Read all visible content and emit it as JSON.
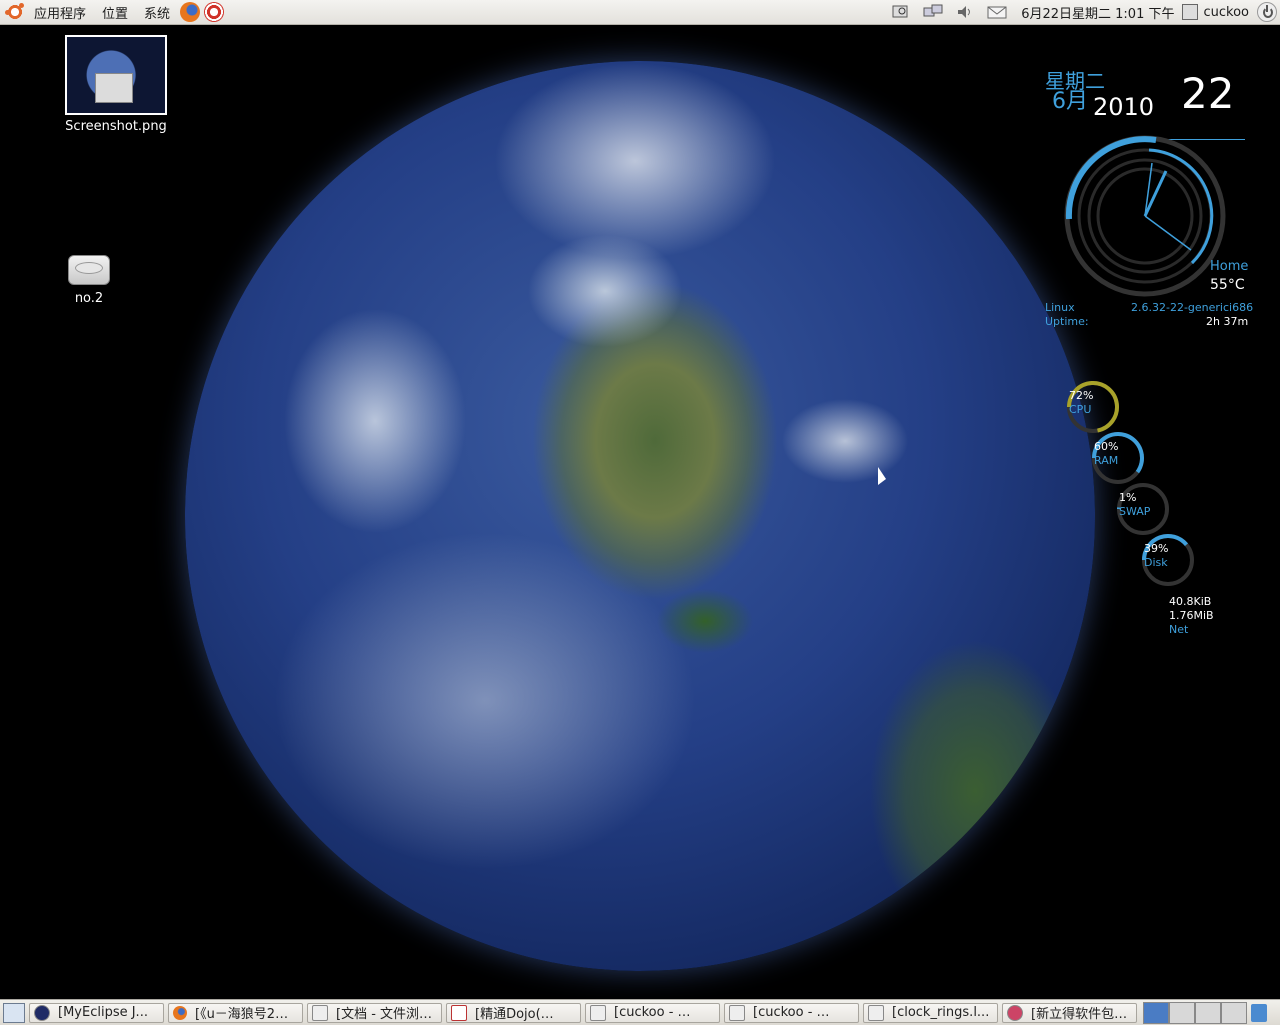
{
  "top_panel": {
    "menu": [
      "应用程序",
      "位置",
      "系统"
    ],
    "clock": "6月22日星期二  1:01 下午",
    "user": "cuckoo"
  },
  "desktop": {
    "icons": [
      {
        "label": "Screenshot.png"
      },
      {
        "label": "no.2"
      }
    ]
  },
  "conky": {
    "weekday": "星期二",
    "month": "6月",
    "year": "2010",
    "day": "22",
    "home_label": "Home",
    "temperature": "55°C",
    "os": "Linux",
    "uptime_label": "Uptime:",
    "kernel": "2.6.32-22-generici686",
    "uptime": "2h 37m",
    "meters": [
      {
        "label": "CPU",
        "value": "72%",
        "fraction": 0.72,
        "color": "#a8a22a"
      },
      {
        "label": "RAM",
        "value": "60%",
        "fraction": 0.6,
        "color": "#3fa0dc"
      },
      {
        "label": "SWAP",
        "value": "1%",
        "fraction": 0.01,
        "color": "#3fa0dc"
      },
      {
        "label": "Disk",
        "value": "39%",
        "fraction": 0.39,
        "color": "#3fa0dc"
      },
      {
        "label": "Net",
        "down": "40.8KiB",
        "up": "1.76MiB",
        "color": "#a8a22a"
      }
    ]
  },
  "taskbar": {
    "tasks": [
      {
        "label": "[MyEclipse J...",
        "icon": "eclipse-icon"
      },
      {
        "label": "[《u－海狼号2…",
        "icon": "firefox-icon"
      },
      {
        "label": "[文档 - 文件浏…",
        "icon": "folder-icon"
      },
      {
        "label": "[精通Dojo(…",
        "icon": "pdf-icon"
      },
      {
        "label": "[cuckoo - …",
        "icon": "terminal-icon"
      },
      {
        "label": "[cuckoo - …",
        "icon": "terminal-icon"
      },
      {
        "label": "[clock_rings.l...",
        "icon": "text-editor-icon"
      },
      {
        "label": "[新立得软件包…",
        "icon": "package-manager-icon"
      }
    ],
    "workspaces": 4,
    "active_workspace": 1
  }
}
